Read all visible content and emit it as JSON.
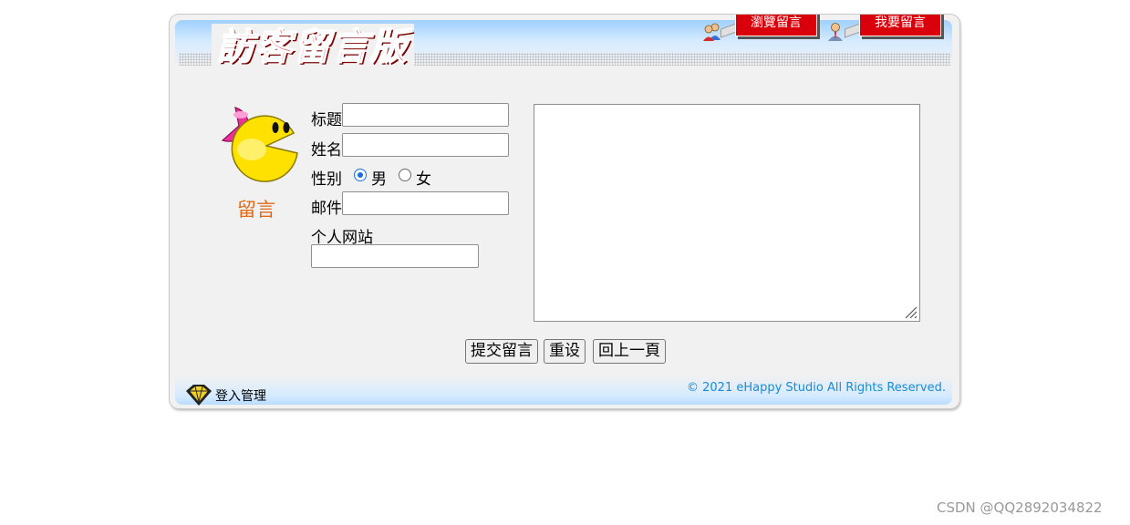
{
  "header": {
    "title": "訪客留言版",
    "nav": [
      {
        "label": "瀏覽留言",
        "icon": "users-icon"
      },
      {
        "label": "我要留言",
        "icon": "user-icon"
      }
    ]
  },
  "mascot": {
    "icon": "pacman-icon",
    "label": "留言"
  },
  "form": {
    "title_label": "标题",
    "title_value": "",
    "name_label": "姓名",
    "name_value": "",
    "gender_label": "性别",
    "gender_options": [
      {
        "label": "男",
        "selected": true
      },
      {
        "label": "女",
        "selected": false
      }
    ],
    "email_label": "邮件",
    "email_value": "",
    "website_label": "个人网站",
    "website_value": "",
    "message_value": ""
  },
  "buttons": {
    "submit": "提交留言",
    "reset": "重设",
    "back": "回上一頁"
  },
  "footer": {
    "login_label": "登入管理",
    "copyright": "© 2021 eHappy Studio All Rights Reserved."
  },
  "watermark": "CSDN @QQ2892034822",
  "colors": {
    "accent_red": "#d9000b",
    "title_red": "#e8182a",
    "link_blue": "#1a8bd6",
    "mascot_label": "#e06a1a",
    "radio_blue": "#1a6fd8"
  }
}
